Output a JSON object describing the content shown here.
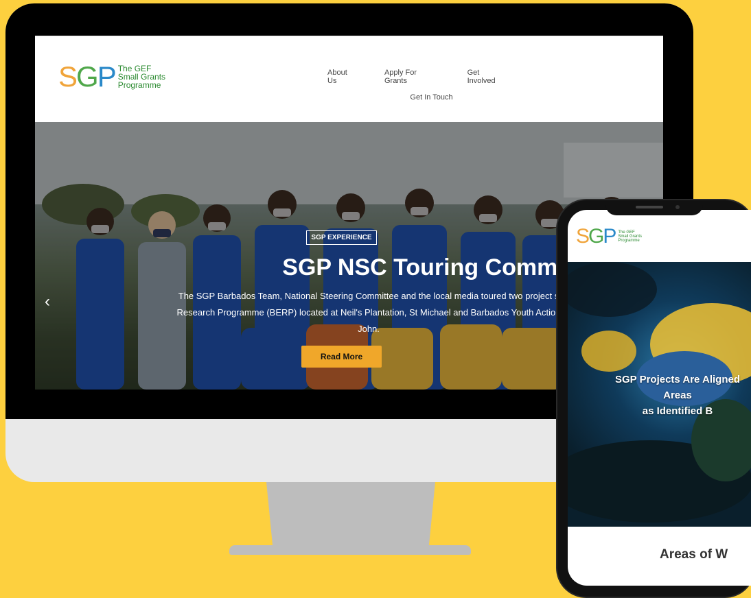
{
  "colors": {
    "background": "#fdd03f",
    "accent_button": "#f0a72a",
    "logo_s": "#f0a43a",
    "logo_g": "#4fa74a",
    "logo_p": "#2a89c9"
  },
  "logo": {
    "mark_s": "S",
    "mark_g": "G",
    "mark_p": "P",
    "line1": "The GEF",
    "line2": "Small Grants",
    "line3": "Programme"
  },
  "nav": {
    "about": "About Us",
    "apply": "Apply For Grants",
    "involved": "Get Involved",
    "touch": "Get In Touch"
  },
  "hero": {
    "tag": "SGP EXPERIENCE",
    "title": "SGP NSC Touring Community P",
    "description_line1": "The SGP Barbados Team, National Steering Committee and the local media toured two project s",
    "description_line2": "Research Programme (BERP) located at Neil's Plantation, St Michael and Barbados Youth Action",
    "description_line3": "John.",
    "button": "Read More",
    "prev_icon": "‹"
  },
  "mobile": {
    "hero_line1": "SGP Projects Are Aligned",
    "hero_line2": "Areas",
    "hero_line3": "as Identified B",
    "section_title": "Areas of W"
  }
}
